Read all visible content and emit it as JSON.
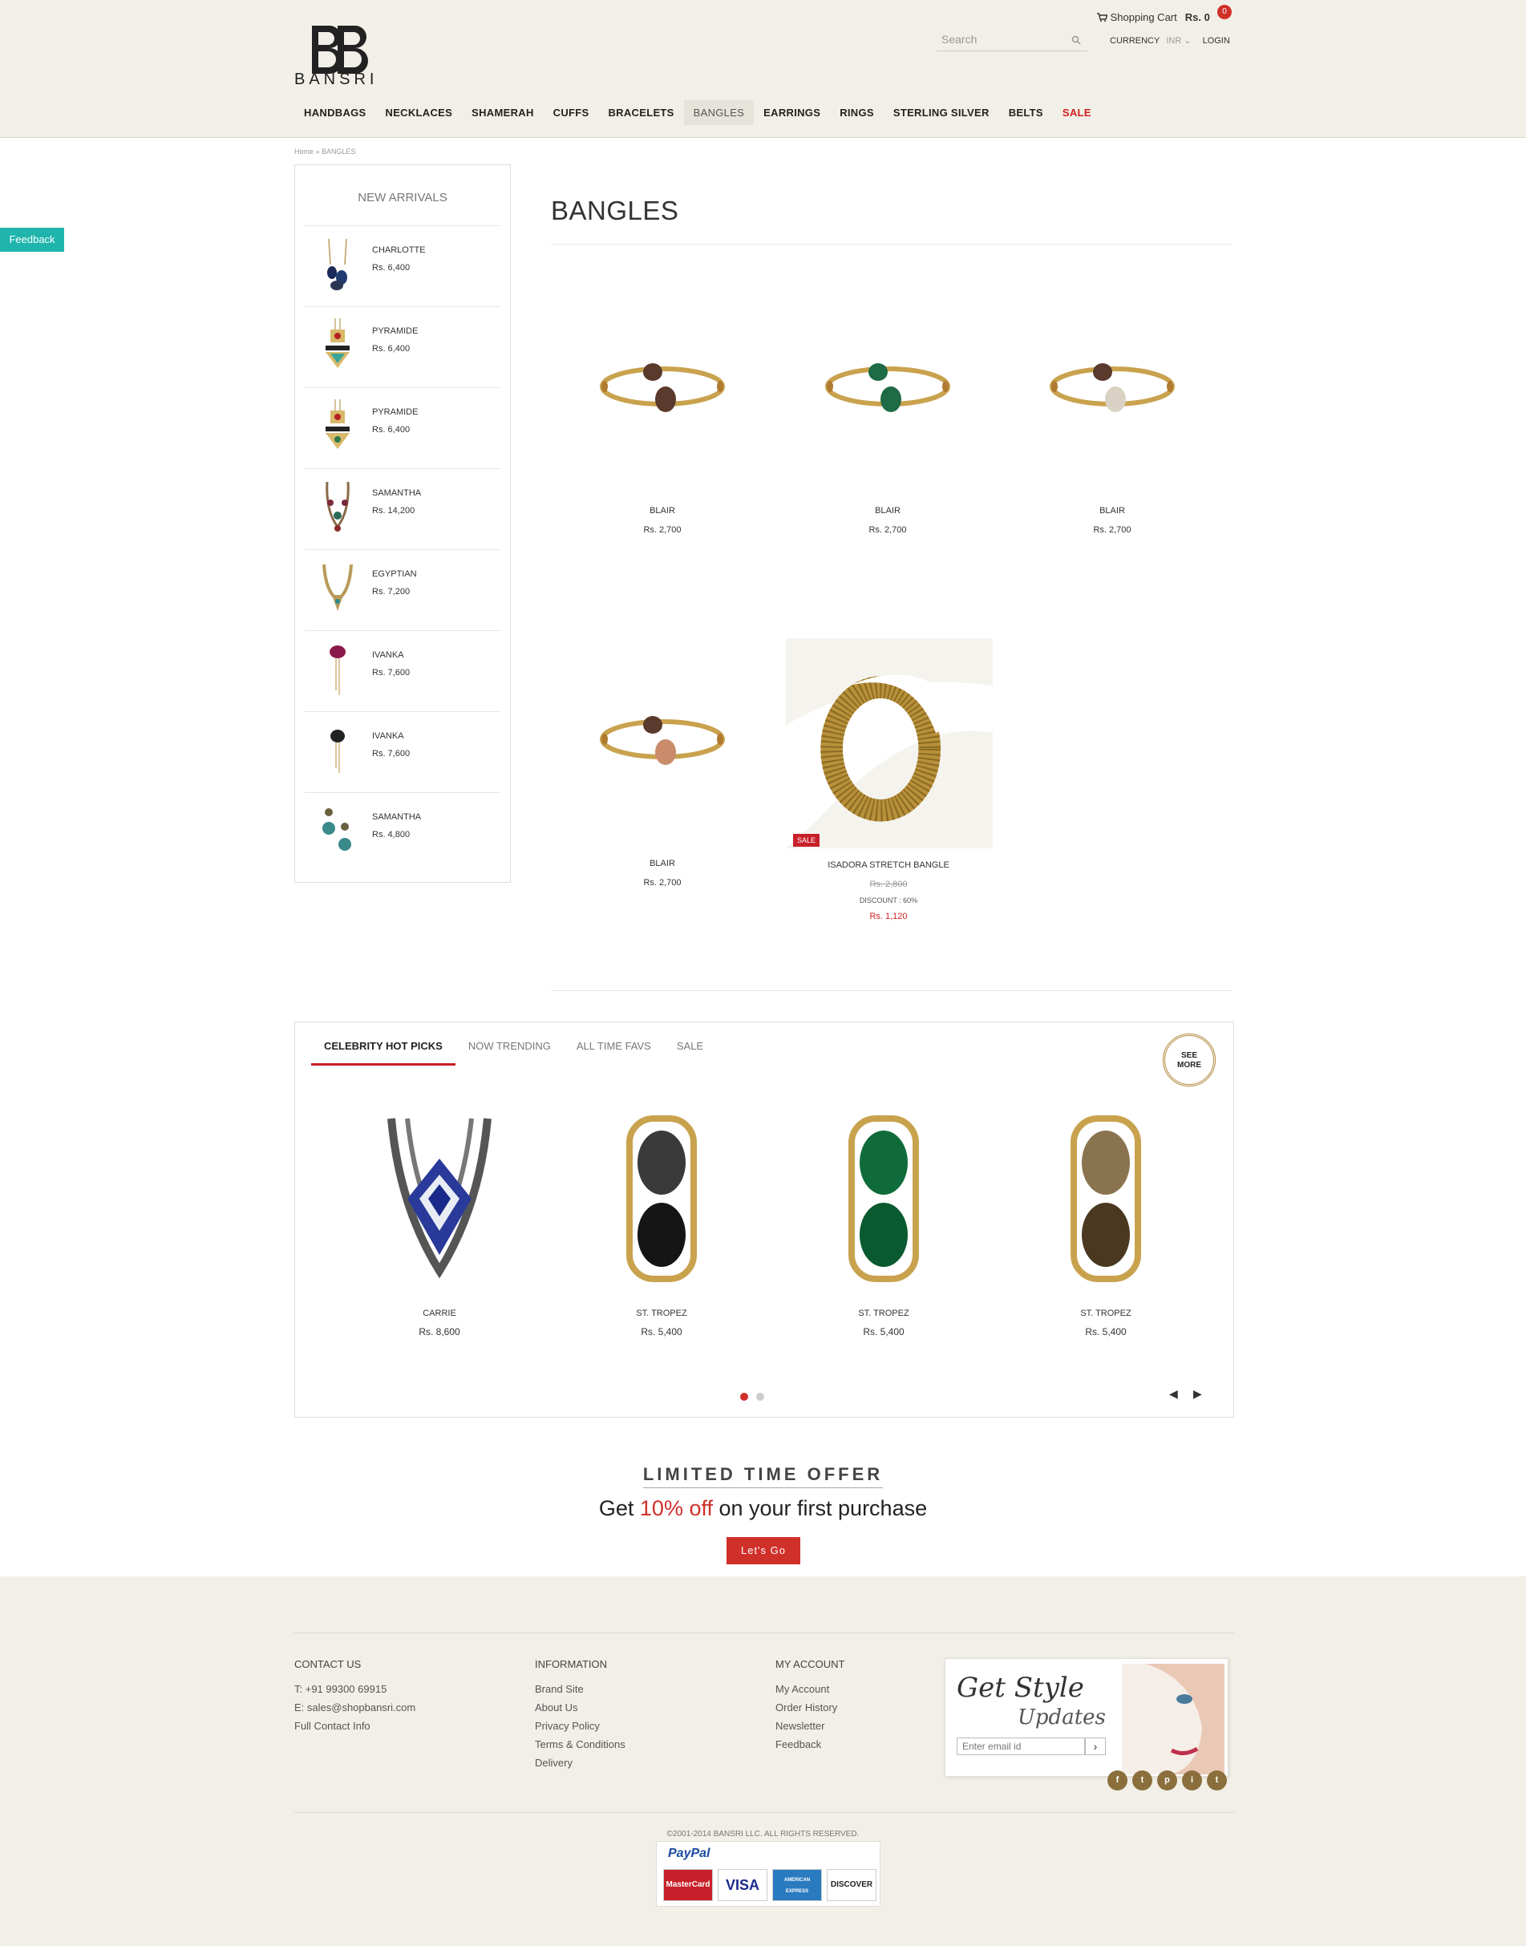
{
  "header": {
    "logo_text": "BANSRI",
    "search_placeholder": "Search",
    "cart_label": "Shopping Cart",
    "cart_total": "Rs. 0",
    "cart_count": "0",
    "currency_label": "CURRENCY",
    "currency_value": "INR",
    "login_label": "LOGIN"
  },
  "nav": [
    "HANDBAGS",
    "NECKLACES",
    "SHAMERAH",
    "CUFFS",
    "BRACELETS",
    "BANGLES",
    "EARRINGS",
    "RINGS",
    "STERLING SILVER",
    "BELTS",
    "SALE"
  ],
  "breadcrumb": "Home » BANGLES",
  "feedback_label": "Feedback",
  "sidebar": {
    "title": "NEW ARRIVALS",
    "items": [
      {
        "name": "CHARLOTTE",
        "price": "Rs. 6,400"
      },
      {
        "name": "PYRAMIDE",
        "price": "Rs. 6,400"
      },
      {
        "name": "PYRAMIDE",
        "price": "Rs. 6,400"
      },
      {
        "name": "SAMANTHA",
        "price": "Rs. 14,200"
      },
      {
        "name": "EGYPTIAN",
        "price": "Rs. 7,200"
      },
      {
        "name": "IVANKA",
        "price": "Rs. 7,600"
      },
      {
        "name": "IVANKA",
        "price": "Rs. 7,600"
      },
      {
        "name": "SAMANTHA",
        "price": "Rs. 4,800"
      }
    ]
  },
  "category": {
    "title": "BANGLES",
    "products": [
      {
        "name": "BLAIR",
        "price": "Rs. 2,700",
        "stone": "#5a3a2c"
      },
      {
        "name": "BLAIR",
        "price": "Rs. 2,700",
        "stone": "#1f6b45"
      },
      {
        "name": "BLAIR",
        "price": "Rs. 2,700",
        "stone": "#d9d2c4"
      },
      {
        "name": "BLAIR",
        "price": "Rs. 2,700",
        "stone": "#c98b6a"
      },
      {
        "name": "ISADORA STRETCH BANGLE",
        "badge": "SALE",
        "old_price": "Rs. 2,800",
        "discount": "DISCOUNT : 60%",
        "price": "Rs. 1,120"
      }
    ]
  },
  "picks": {
    "tabs": [
      "CELEBRITY HOT PICKS",
      "NOW TRENDING",
      "ALL TIME FAVS",
      "SALE"
    ],
    "see_more": [
      "SEE",
      "MORE"
    ],
    "items": [
      {
        "name": "CARRIE",
        "price": "Rs. 8,600"
      },
      {
        "name": "ST. TROPEZ",
        "price": "Rs. 5,400",
        "stone": "#3a3a3a"
      },
      {
        "name": "ST. TROPEZ",
        "price": "Rs. 5,400",
        "stone": "#0f6b3a"
      },
      {
        "name": "ST. TROPEZ",
        "price": "Rs. 5,400",
        "stone": "#6b5636"
      }
    ]
  },
  "offer": {
    "heading": "LIMITED TIME OFFER",
    "line_pre": "Get ",
    "line_hl": "10% off",
    "line_post": " on your first purchase",
    "button": "Let's Go"
  },
  "footer": {
    "contact": {
      "title": "CONTACT US",
      "items": [
        "T: +91 99300 69915",
        "E: sales@shopbansri.com",
        "Full Contact Info"
      ]
    },
    "information": {
      "title": "INFORMATION",
      "items": [
        "Brand Site",
        "About Us",
        "Privacy Policy",
        "Terms & Conditions",
        "Delivery"
      ]
    },
    "account": {
      "title": "MY ACCOUNT",
      "items": [
        "My Account",
        "Order History",
        "Newsletter",
        "Feedback"
      ]
    },
    "newsletter": {
      "title_1": "Get Style",
      "title_2": "Updates",
      "placeholder": "Enter email id"
    },
    "social": [
      "f",
      "t",
      "p",
      "i",
      "t"
    ],
    "copyright": "©2001-2014 BANSRI LLC. ALL RIGHTS RESERVED.",
    "payments": {
      "paypal": "PayPal",
      "cards": [
        "MasterCard",
        "VISA",
        "AMERICAN EXPRESS",
        "DISCOVER"
      ]
    }
  }
}
